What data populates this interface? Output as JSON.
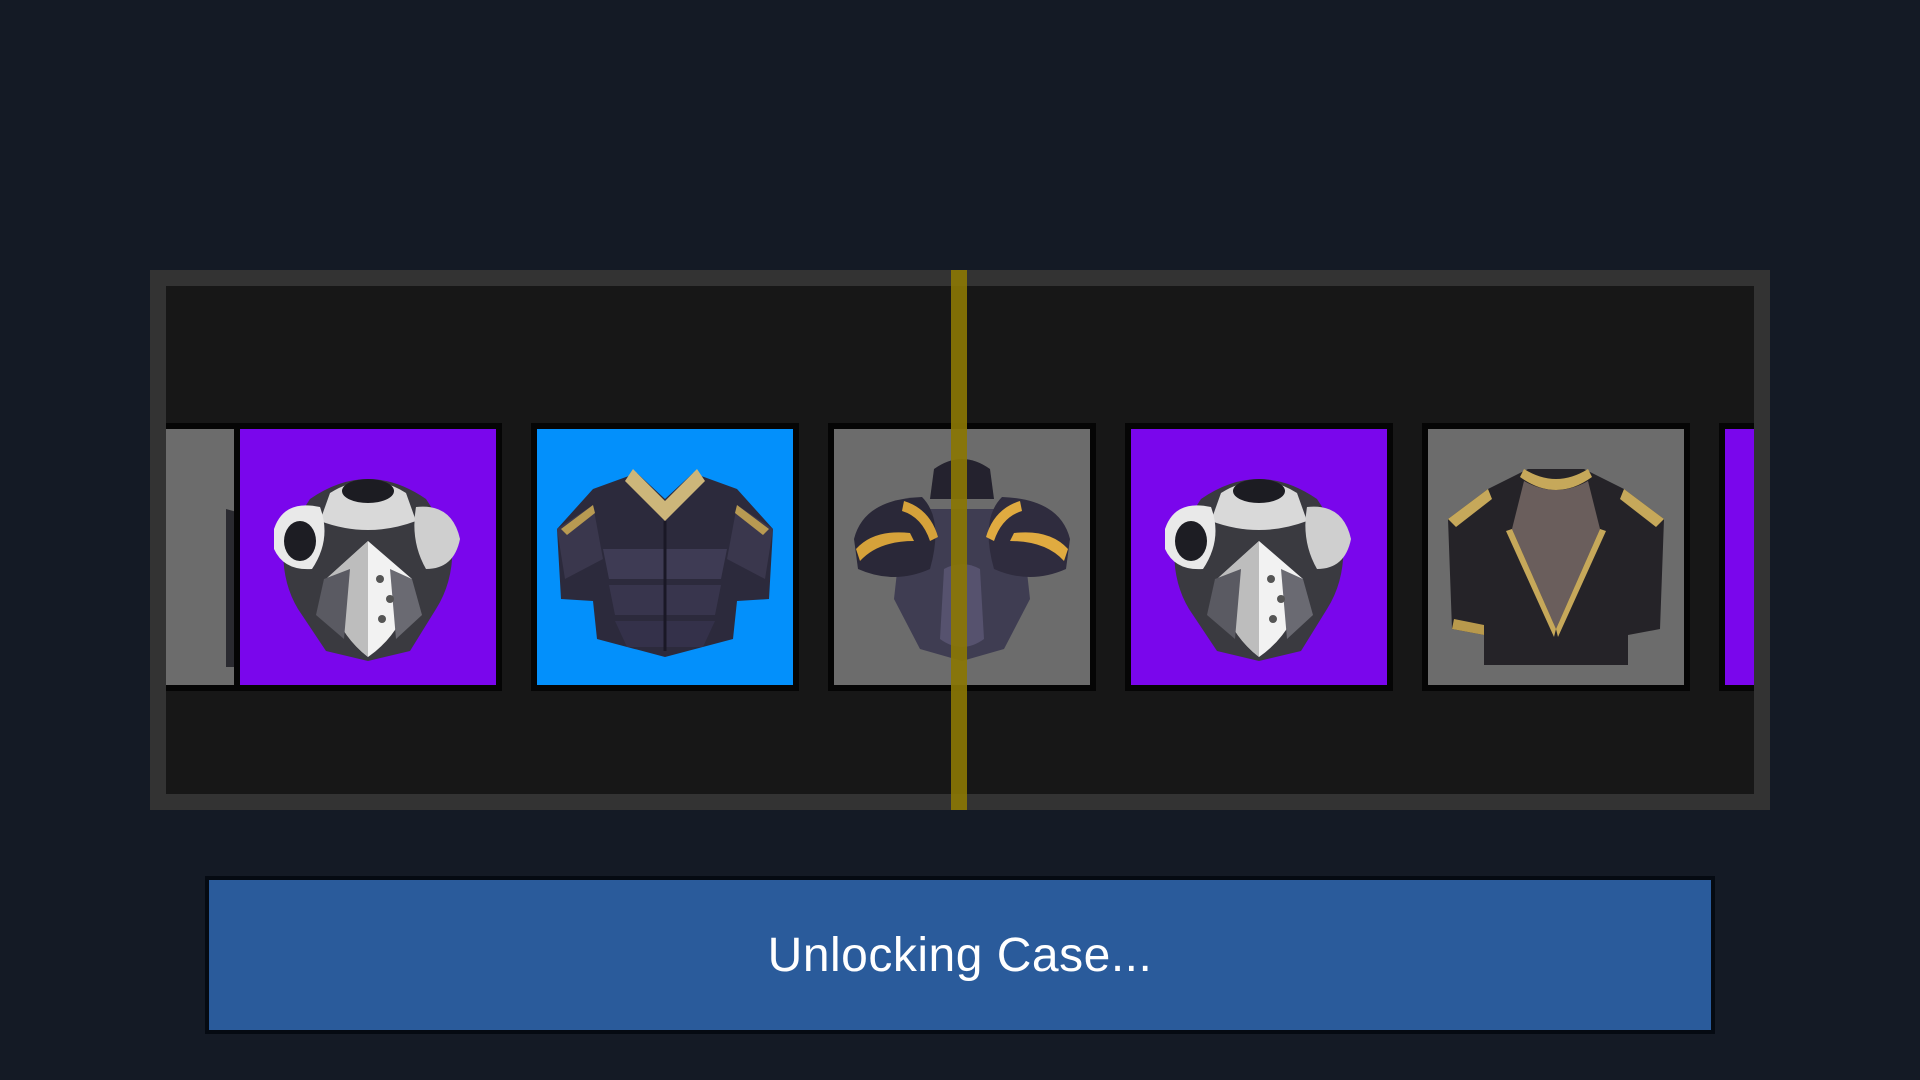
{
  "unlock_button": {
    "label": "Unlocking Case..."
  },
  "reel": {
    "items": [
      {
        "name": "partial-left-item",
        "rarity": "gray",
        "icon": "armor-partial-icon"
      },
      {
        "name": "silver-plate-armor",
        "rarity": "purple",
        "icon": "silver-plate-armor-icon"
      },
      {
        "name": "dark-gold-trim-armor",
        "rarity": "blue",
        "icon": "dark-gold-trim-armor-icon"
      },
      {
        "name": "dark-pauldron-armor",
        "rarity": "gray",
        "icon": "dark-pauldron-armor-icon"
      },
      {
        "name": "silver-plate-armor",
        "rarity": "purple",
        "icon": "silver-plate-armor-icon"
      },
      {
        "name": "cloth-tunic-armor",
        "rarity": "gray",
        "icon": "cloth-tunic-armor-icon"
      },
      {
        "name": "partial-right-item",
        "rarity": "purple",
        "icon": "armor-partial-icon"
      }
    ]
  },
  "colors": {
    "background": "#141a25",
    "frame": "#333333",
    "window": "#171717",
    "pointer": "#8a7604",
    "button": "#2a5b9b",
    "rarity_purple": "#7a06ec",
    "rarity_blue": "#0390fb",
    "rarity_gray": "#6c6c6c"
  }
}
